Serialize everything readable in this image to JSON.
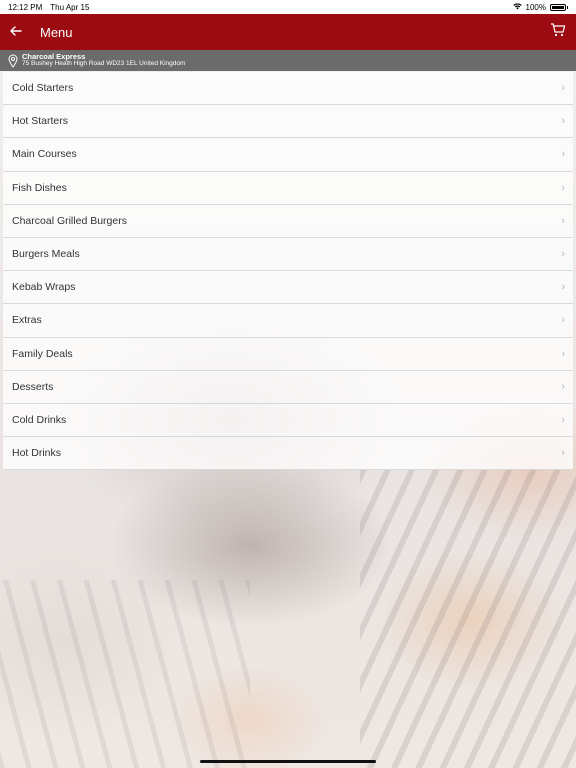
{
  "status": {
    "time": "12:12 PM",
    "date": "Thu Apr 15",
    "battery": "100%"
  },
  "header": {
    "title": "Menu",
    "back_icon": "back-arrow-icon",
    "cart_icon": "cart-icon",
    "bg_color": "#9b0b11"
  },
  "location": {
    "name": "Charcoal Express",
    "address": "75 Bushey Heath High Road WD23 1EL United Kingdom"
  },
  "menu": {
    "items": [
      {
        "label": "Cold Starters"
      },
      {
        "label": "Hot Starters"
      },
      {
        "label": "Main Courses"
      },
      {
        "label": "Fish Dishes"
      },
      {
        "label": "Charcoal Grilled Burgers"
      },
      {
        "label": "Burgers Meals"
      },
      {
        "label": "Kebab Wraps"
      },
      {
        "label": "Extras"
      },
      {
        "label": "Family Deals"
      },
      {
        "label": "Desserts"
      },
      {
        "label": "Cold Drinks"
      },
      {
        "label": "Hot Drinks"
      }
    ]
  }
}
